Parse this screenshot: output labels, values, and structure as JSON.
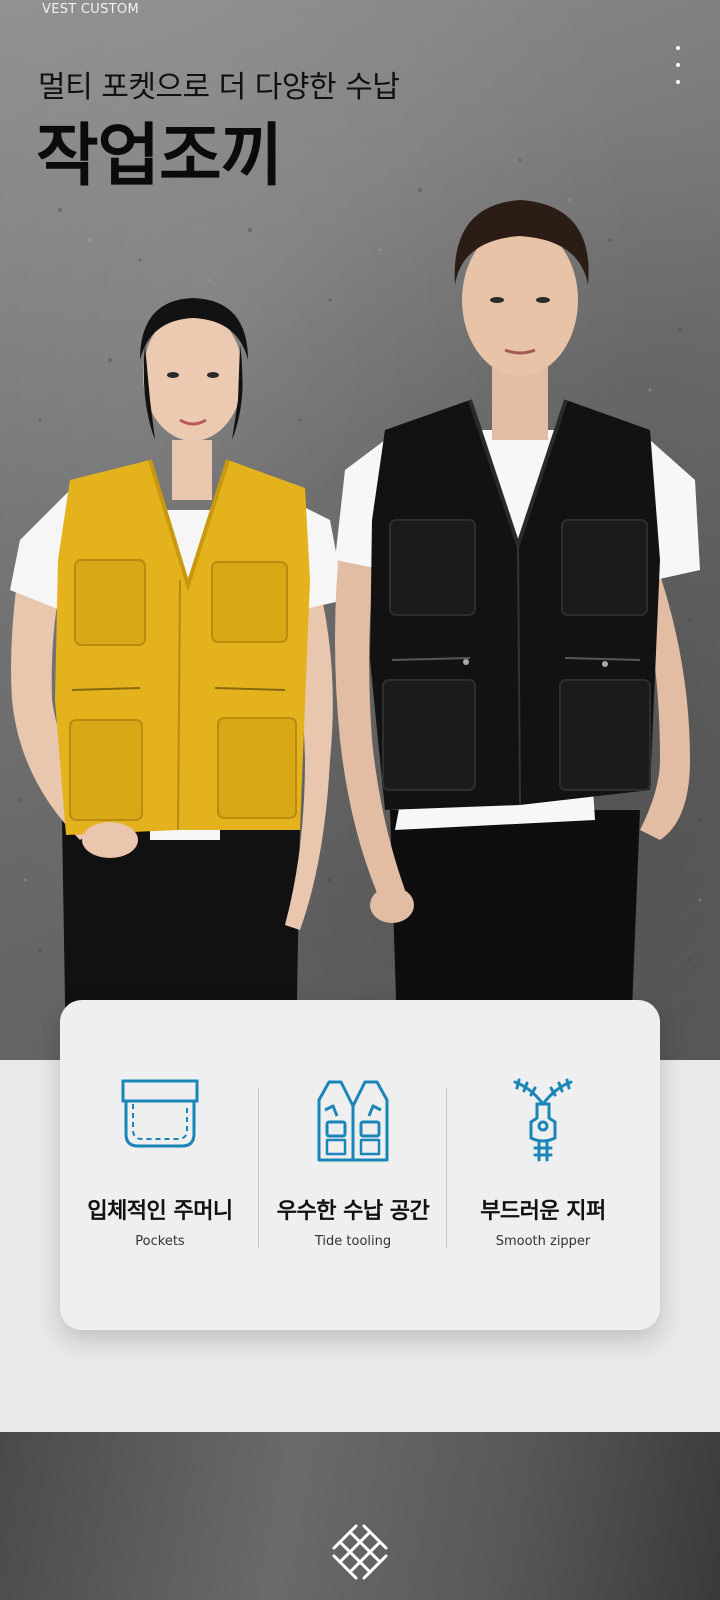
{
  "hero": {
    "brand_tag": "VEST CUSTOM",
    "subtitle": "멀티 포켓으로 더 다양한 수납",
    "title": "작업조끼",
    "models": [
      {
        "vest_color": "#e3b21c",
        "label": "yellow vest model"
      },
      {
        "vest_color": "#121212",
        "label": "black vest model"
      }
    ]
  },
  "features": [
    {
      "icon": "pocket-icon",
      "title_ko": "입체적인 주머니",
      "title_en": "Pockets"
    },
    {
      "icon": "vest-icon",
      "title_ko": "우수한 수납 공간",
      "title_en": "Tide tooling"
    },
    {
      "icon": "zipper-icon",
      "title_ko": "부드러운 지퍼",
      "title_en": "Smooth zipper"
    }
  ],
  "colors": {
    "accent_icon": "#1a86b8",
    "card_bg": "#efefef",
    "page_bg": "#e9e9e9"
  },
  "bottom": {
    "icon": "weave-fabric-icon"
  }
}
